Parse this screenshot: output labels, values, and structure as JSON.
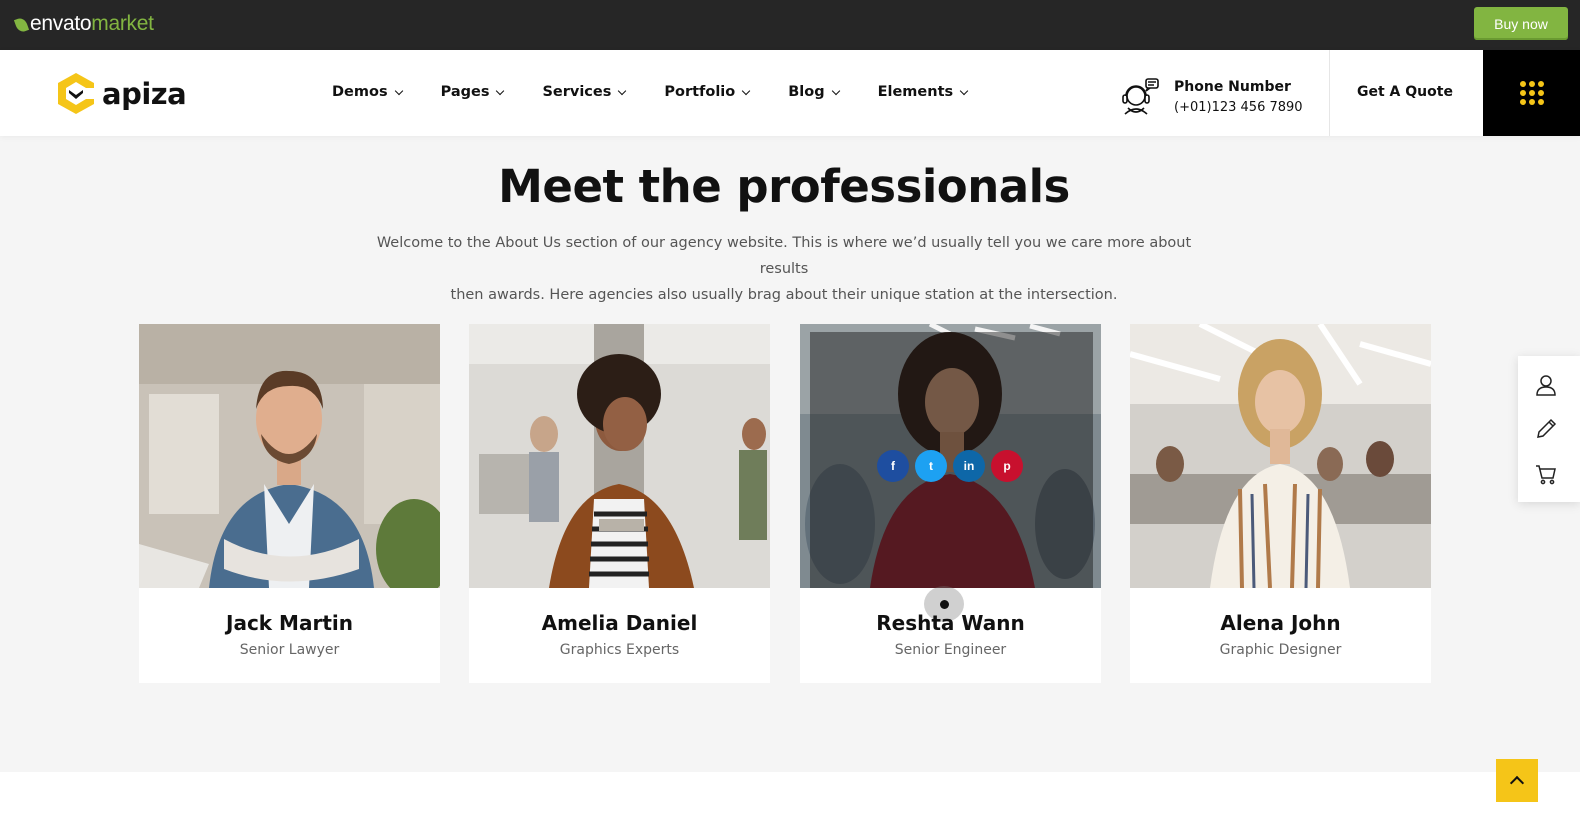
{
  "envato": {
    "brand": "envato",
    "brand_suffix": "market",
    "buy_label": "Buy now",
    "accent": "#82b541"
  },
  "header": {
    "logo_text": "apiza",
    "nav": [
      {
        "label": "Demos"
      },
      {
        "label": "Pages"
      },
      {
        "label": "Services"
      },
      {
        "label": "Portfolio"
      },
      {
        "label": "Blog"
      },
      {
        "label": "Elements"
      }
    ],
    "phone_label": "Phone Number",
    "phone_number": "(+01)123 456 7890",
    "quote_label": "Get A Quote",
    "accent": "#f5c518"
  },
  "section": {
    "title": "Meet the professionals",
    "desc_line1": "Welcome to the About Us section of our agency website. This is where we’d usually tell you we care more about results",
    "desc_line2": "then awards. Here agencies also usually brag about their unique station at the intersection."
  },
  "team": [
    {
      "name": "Jack Martin",
      "role": "Senior Lawyer"
    },
    {
      "name": "Amelia Daniel",
      "role": "Graphics Experts"
    },
    {
      "name": "Reshta Wann",
      "role": "Senior Engineer"
    },
    {
      "name": "Alena John",
      "role": "Graphic Designer"
    }
  ],
  "socials": [
    {
      "icon": "f",
      "name": "facebook",
      "color": "#1e4ea0"
    },
    {
      "icon": "t",
      "name": "twitter",
      "color": "#1da1f2"
    },
    {
      "icon": "in",
      "name": "linkedin",
      "color": "#0e67a8"
    },
    {
      "icon": "p",
      "name": "pinterest",
      "color": "#c8102e"
    }
  ],
  "side_panel": [
    "user-icon",
    "pencil-icon",
    "cart-icon"
  ]
}
